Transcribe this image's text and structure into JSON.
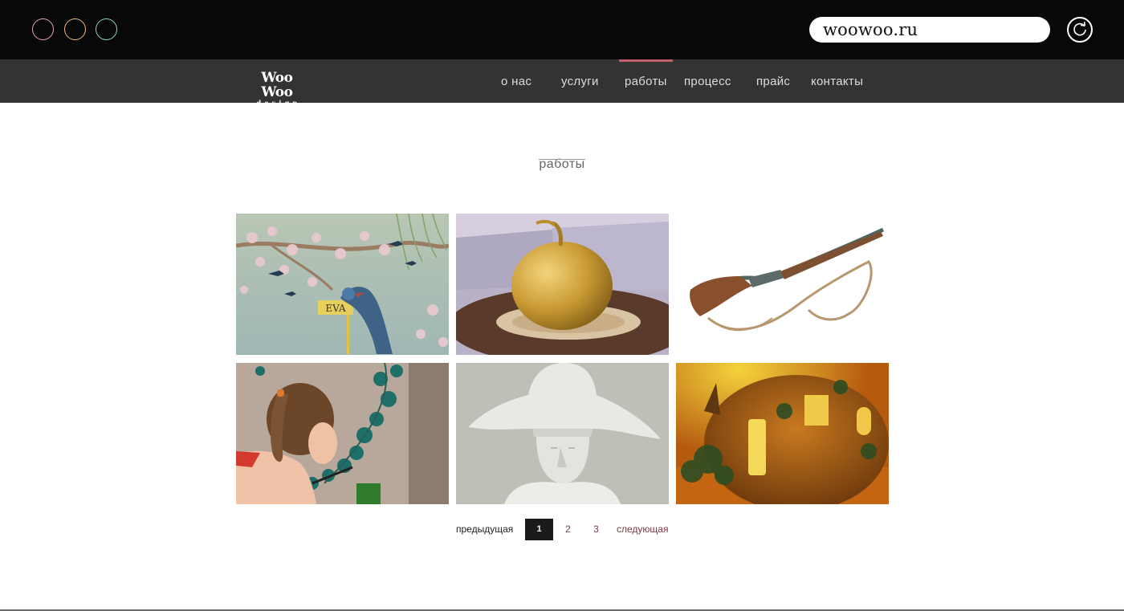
{
  "browser": {
    "url": "woowoo.ru",
    "window_buttons": [
      {
        "name": "close",
        "color": "#e9a0bf"
      },
      {
        "name": "minimize",
        "color": "#e9b889"
      },
      {
        "name": "maximize",
        "color": "#8fd9b0"
      }
    ],
    "reload_icon": "refresh-icon"
  },
  "site": {
    "logo_line1": "Woo Woo",
    "logo_line2": "design",
    "nav": [
      {
        "label": "о нас",
        "active": false
      },
      {
        "label": "услуги",
        "active": false
      },
      {
        "label": "работы",
        "active": true
      },
      {
        "label": "процесс",
        "active": false
      },
      {
        "label": "прайс",
        "active": false
      },
      {
        "label": "контакты",
        "active": false
      }
    ],
    "accent_color": "#c35e6b"
  },
  "main": {
    "title": "работы",
    "gallery": [
      {
        "subject": "painted wall mural with birds and blossoms",
        "sign_text": "EVA"
      },
      {
        "subject": "golden apple on a wood slice"
      },
      {
        "subject": "vintage rifle with rope strap"
      },
      {
        "subject": "woman painting a teal leaf vine on a wall"
      },
      {
        "subject": "white plaster bust in a bicorne hat"
      },
      {
        "subject": "glowing pumpkin lantern house"
      }
    ]
  },
  "pagination": {
    "prev_label": "предыдущая",
    "pages": [
      "1",
      "2",
      "3"
    ],
    "current_page": "1",
    "next_label": "следующая"
  }
}
